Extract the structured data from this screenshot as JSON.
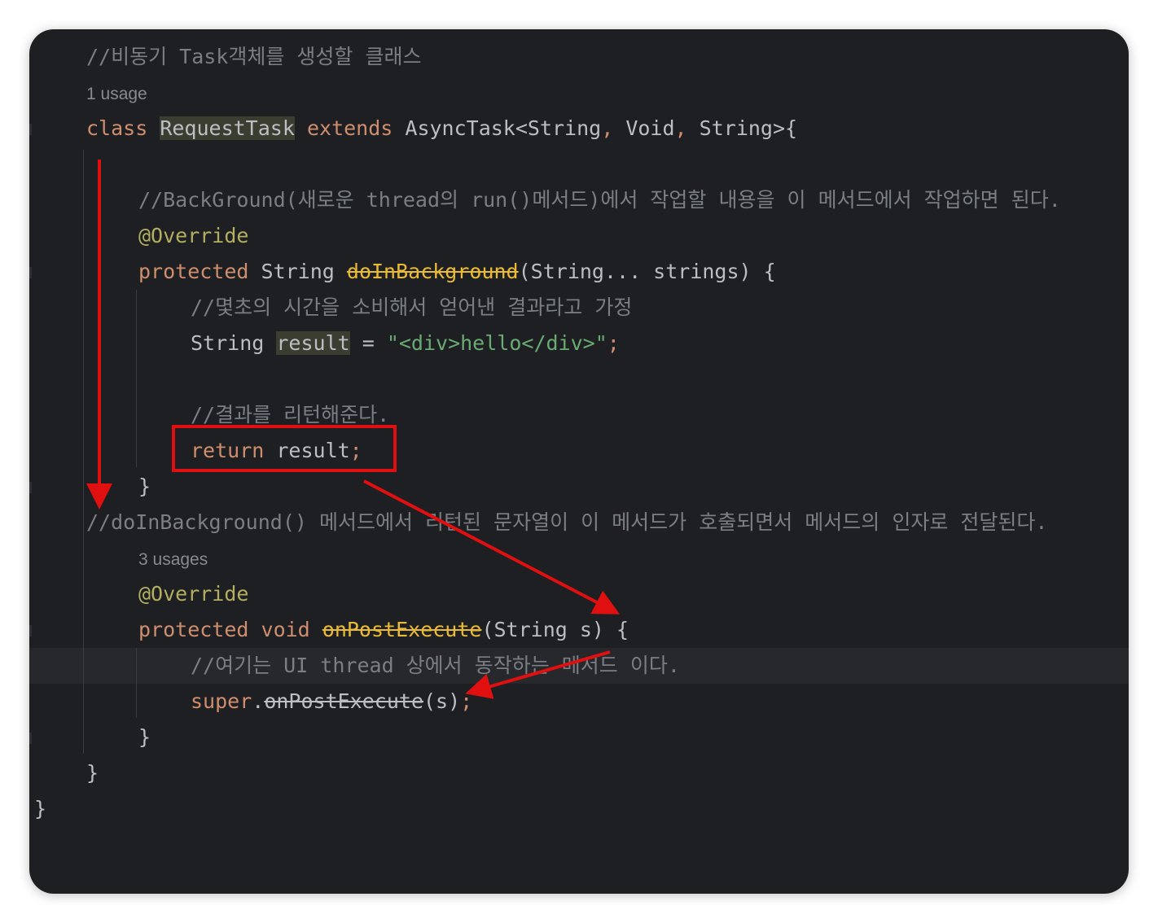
{
  "code": {
    "l1_comment": "//비동기 Task객체를 생성할 클래스",
    "inlay_1": "1 usage",
    "l2": {
      "class_kw": "class",
      "class_name": "RequestTask",
      "extends_kw": "extends",
      "parent_type": "AsyncTask<String",
      "comma1": ",",
      "void_type": " Void",
      "comma2": ",",
      "string_type": " String>{"
    },
    "l3_comment": "//BackGround(새로운 thread의 run()메서드)에서 작업할 내용을 이 메서드에서 작업하면 된다.",
    "l4_annotation": "@Override",
    "l5": {
      "protected_kw": "protected",
      "return_type": " String ",
      "method_name": "doInBackground",
      "params": "(String... strings) {"
    },
    "l6_comment": "//몇초의 시간을 소비해서 얻어낸 결과라고 가정",
    "l7": {
      "type": "String ",
      "var": "result",
      "assign": " = ",
      "literal": "\"<div>hello</div>\"",
      "semicolon": ";"
    },
    "l8_comment": "//결과를 리턴해준다.",
    "l9": {
      "return_kw": "return",
      "value": " result",
      "semicolon": ";"
    },
    "l10_brace": "}",
    "l11_comment": "//doInBackground() 메서드에서 리턴된 문자열이 이 메서드가 호출되면서 메서드의 인자로 전달된다.",
    "inlay_2": "3 usages",
    "l12_annotation": "@Override",
    "l13": {
      "protected_kw": "protected",
      "void_kw": " void ",
      "method_name": "onPostExecute",
      "params": "(String s) {"
    },
    "l14_comment": "//여기는 UI thread 상에서 동작하는 메서드 이다.",
    "l15": {
      "super_kw": "super",
      "dot": ".",
      "method_name": "onPostExecute",
      "args": "(s)",
      "semicolon": ";"
    },
    "l16_brace": "}",
    "l17_brace": "}",
    "l18_brace": "}"
  },
  "colors": {
    "background": "#1e1f22",
    "keyword": "#cf8e6d",
    "comment": "#7a7e85",
    "annotation": "#b3ae60",
    "string": "#6aab73",
    "text": "#bcbec4",
    "method_decl": "#e8ba36",
    "markup_red": "#e01010"
  }
}
